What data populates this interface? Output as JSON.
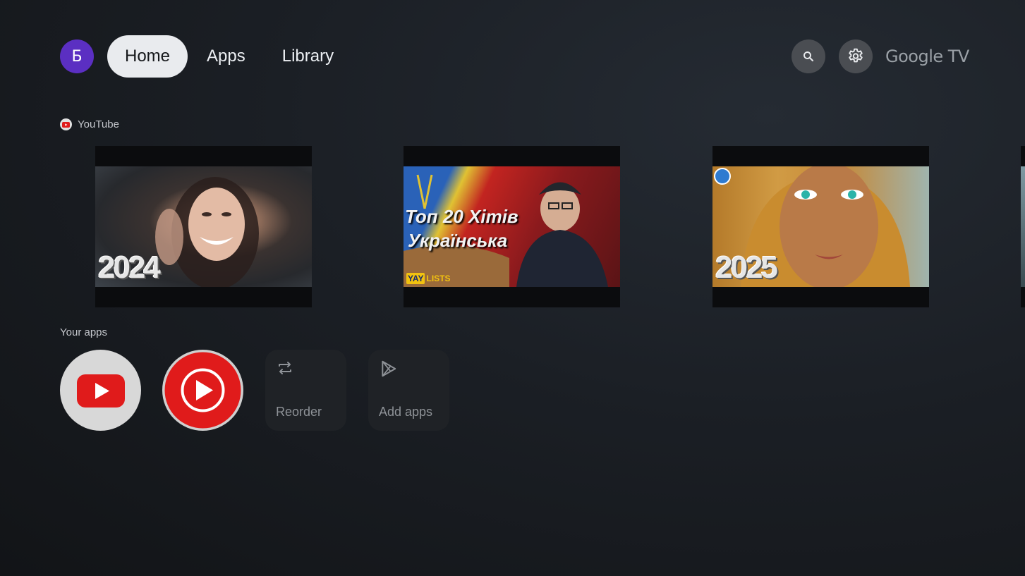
{
  "header": {
    "avatar_letter": "Б",
    "nav": [
      {
        "label": "Home",
        "active": true
      },
      {
        "label": "Apps",
        "active": false
      },
      {
        "label": "Library",
        "active": false
      }
    ],
    "search_icon": "search-icon",
    "settings_icon": "gear-icon",
    "brand": "Google TV"
  },
  "youtube_row": {
    "label": "YouTube",
    "cards": [
      {
        "overlay_text": "2024"
      },
      {
        "overlay_title_line1": "Топ 20 Хітів",
        "overlay_title_line2": "Українська",
        "badge_a": "YAY",
        "badge_b": "LISTS"
      },
      {
        "overlay_text": "2025"
      }
    ]
  },
  "apps_row": {
    "label": "Your apps",
    "apps": [
      {
        "name": "YouTube",
        "icon": "youtube-icon"
      },
      {
        "name": "YouTube Music",
        "icon": "youtube-music-icon"
      }
    ],
    "actions": [
      {
        "label": "Reorder",
        "icon": "reorder-icon"
      },
      {
        "label": "Add apps",
        "icon": "play-store-icon"
      }
    ]
  },
  "colors": {
    "avatar": "#5b2fc2",
    "youtube_red": "#e01b1b",
    "active_pill": "#e9ebee"
  }
}
